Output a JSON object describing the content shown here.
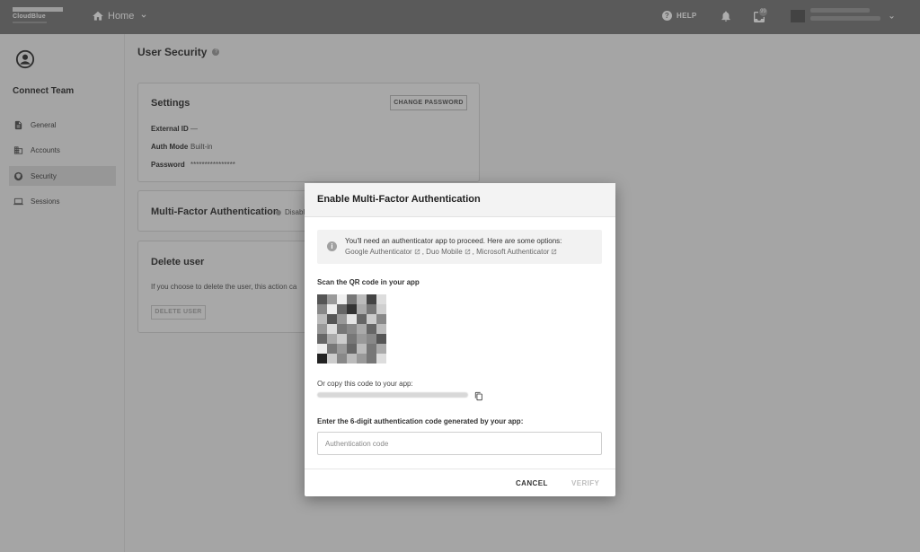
{
  "topbar": {
    "logo_text": "CloudBlue",
    "home_label": "Home",
    "help_label": "HELP",
    "tasks_badge": "99"
  },
  "sidebar": {
    "team_name": "Connect Team",
    "items": [
      {
        "label": "General",
        "icon": "document-icon"
      },
      {
        "label": "Accounts",
        "icon": "building-icon"
      },
      {
        "label": "Security",
        "icon": "shield-icon",
        "active": true
      },
      {
        "label": "Sessions",
        "icon": "laptop-icon"
      }
    ]
  },
  "main": {
    "page_title": "User Security",
    "settings": {
      "title": "Settings",
      "change_password_label": "CHANGE PASSWORD",
      "fields": [
        {
          "key": "External ID",
          "value": "—"
        },
        {
          "key": "Auth Mode",
          "value": "Built-in"
        },
        {
          "key": "Password",
          "value": "****************"
        }
      ]
    },
    "mfa": {
      "title": "Multi-Factor Authentication",
      "status": "Disabl"
    },
    "delete": {
      "title": "Delete user",
      "description": "If you choose to delete the user, this action ca",
      "button_label": "DELETE USER"
    }
  },
  "dialog": {
    "title": "Enable Multi-Factor Authentication",
    "notice_line1": "You'll need an authenticator app to proceed. Here are some options:",
    "apps": [
      "Google Authenticator",
      "Duo Mobile",
      "Microsoft Authenticator"
    ],
    "scan_label": "Scan the QR code in your app",
    "copy_label": "Or copy this code to your app:",
    "code_label": "Enter the 6-digit authentication code generated by your app:",
    "code_placeholder": "Authentication code",
    "cancel_label": "CANCEL",
    "verify_label": "VERIFY"
  },
  "colors": {
    "topbar": "#7a7a7a",
    "overlay": "rgba(40,40,40,0.38)",
    "disabled_text": "#bdbdbd"
  }
}
